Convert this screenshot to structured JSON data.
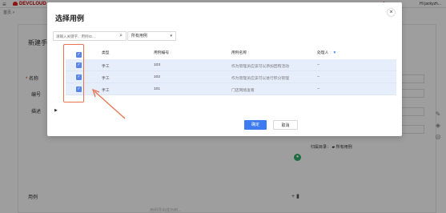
{
  "app": {
    "logo": "DEVCLOUD",
    "user": "Hi jackyzh...",
    "nav": "... ... ... ... ...",
    "breadcrumb": "首页 >"
  },
  "background": {
    "title": "新建手...",
    "labels": {
      "name": "名称",
      "number": "编号",
      "desc": "描述",
      "usecases": "用例"
    },
    "required_mark": "*",
    "directory_label": "归属目录：",
    "directory_value": "所有用例",
    "faint_text": "用例导出成功到..."
  },
  "modal": {
    "title": "选择用例",
    "close_icon": "×",
    "search_placeholder": "请输入关键字、用例ID...",
    "filter_value": "所有用例",
    "columns": {
      "type": "类型",
      "id": "用例编号",
      "name": "用例名称",
      "owner": "处理人"
    },
    "rows": [
      {
        "type": "手工",
        "id": "103",
        "name": "作为管理员应该可以添加团购活动",
        "owner": "--",
        "checked": true
      },
      {
        "type": "手工",
        "id": "102",
        "name": "作为管理员应该可以进行积分管理",
        "owner": "--",
        "checked": true
      },
      {
        "type": "手工",
        "id": "101",
        "name": "门店网络查看",
        "owner": "--",
        "checked": true
      }
    ],
    "expand_label": "▶",
    "ok_label": "确定",
    "cancel_label": "取消"
  },
  "colors": {
    "accent": "#3e7bf1",
    "highlight": "#e7734f",
    "row_selected": "#e6eefc"
  }
}
